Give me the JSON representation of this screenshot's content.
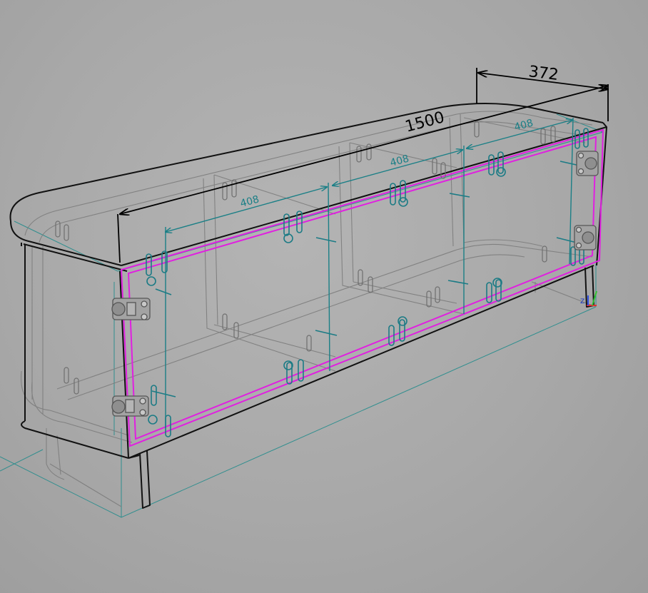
{
  "model": {
    "name": "tv-stand-cabinet",
    "colors": {
      "background": "#a9a9a9",
      "outline": "#111111",
      "ghost_edges": "#8a8a8a",
      "selection": "#e020e0",
      "construction": "#1a8a8a",
      "hardware": "#1b7b85"
    }
  },
  "dimensions": {
    "overall_length": "1500",
    "depth": "372",
    "compartment_1": "408",
    "compartment_2": "408",
    "compartment_3": "408"
  },
  "axis_gizmo": {
    "z_label": "Z",
    "colors": {
      "x": "#e03030",
      "y": "#30c030",
      "z": "#3050e0"
    }
  }
}
